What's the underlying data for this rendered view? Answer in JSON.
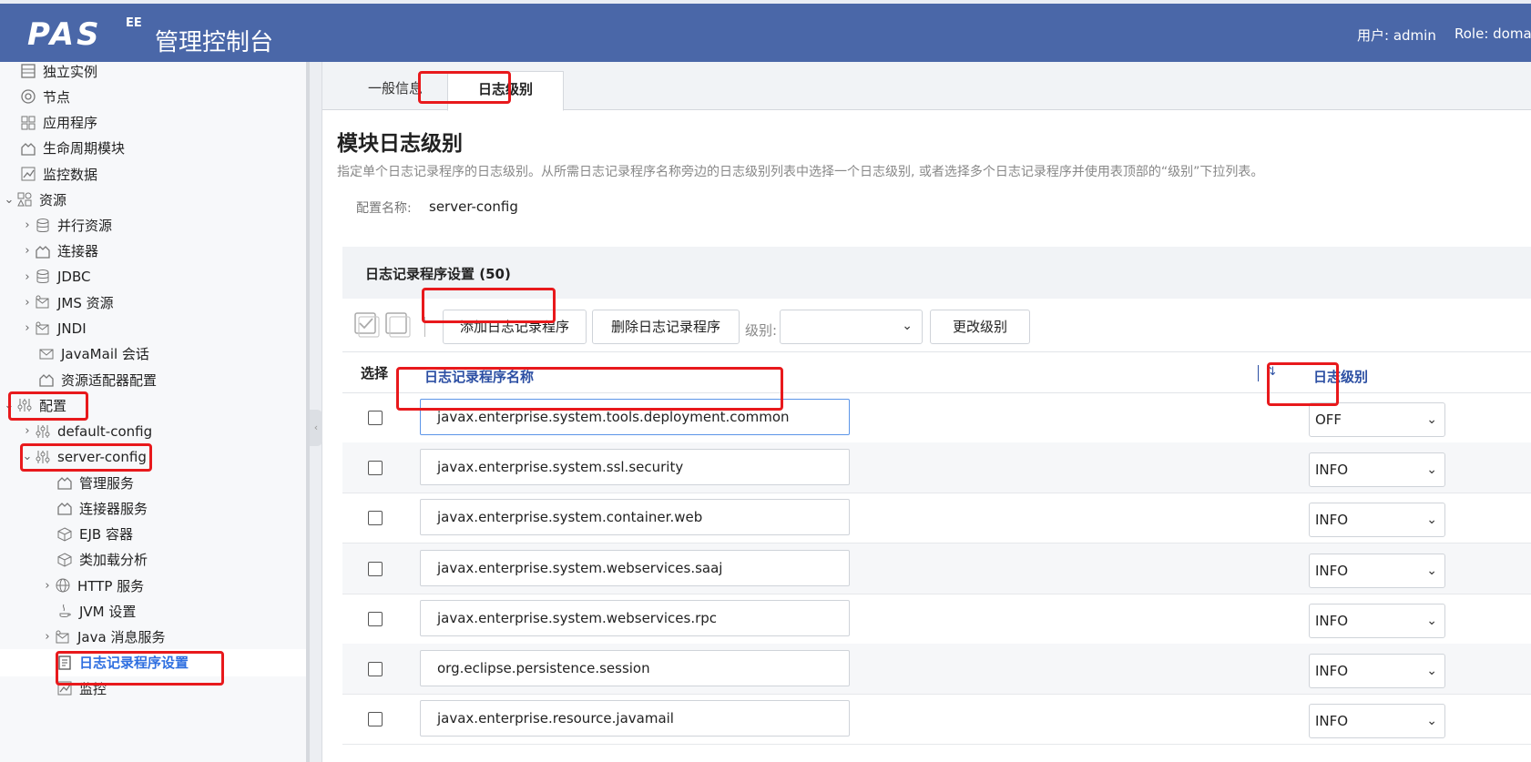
{
  "header": {
    "logo": "PAS",
    "logo_sup": "EE",
    "title": "管理控制台",
    "user": "用户: admin",
    "role": "Role: doma"
  },
  "sidebar": {
    "items": [
      {
        "label": "独立实例",
        "icon": "server-icon"
      },
      {
        "label": "节点",
        "icon": "node-icon"
      },
      {
        "label": "应用程序",
        "icon": "apps-icon"
      },
      {
        "label": "生命周期模块",
        "icon": "module-icon"
      },
      {
        "label": "监控数据",
        "icon": "chart-icon"
      },
      {
        "label": "资源",
        "icon": "resources-icon"
      },
      {
        "label": "并行资源",
        "icon": "database-icon"
      },
      {
        "label": "连接器",
        "icon": "module-icon"
      },
      {
        "label": "JDBC",
        "icon": "database-icon"
      },
      {
        "label": "JMS 资源",
        "icon": "jms-icon"
      },
      {
        "label": "JNDI",
        "icon": "jms-icon"
      },
      {
        "label": "JavaMail 会话",
        "icon": "mail-icon"
      },
      {
        "label": "资源适配器配置",
        "icon": "module-icon"
      },
      {
        "label": "配置",
        "icon": "sliders-icon"
      },
      {
        "label": "default-config",
        "icon": "sliders-icon"
      },
      {
        "label": "server-config",
        "icon": "sliders-icon"
      },
      {
        "label": "管理服务",
        "icon": "module-icon"
      },
      {
        "label": "连接器服务",
        "icon": "module-icon"
      },
      {
        "label": "EJB 容器",
        "icon": "cube-icon"
      },
      {
        "label": "类加载分析",
        "icon": "cube-icon"
      },
      {
        "label": "HTTP 服务",
        "icon": "globe-icon"
      },
      {
        "label": "JVM 设置",
        "icon": "java-icon"
      },
      {
        "label": "Java 消息服务",
        "icon": "jms-icon"
      },
      {
        "label": "日志记录程序设置",
        "icon": "log-icon"
      },
      {
        "label": "监控",
        "icon": "chart-icon"
      }
    ]
  },
  "tabs": {
    "general": "一般信息",
    "log_level": "日志级别"
  },
  "page": {
    "title": "模块日志级别",
    "description": "指定单个日志记录程序的日志级别。从所需日志记录程序名称旁边的日志级别列表中选择一个日志级别, 或者选择多个日志记录程序并使用表顶部的“级别”下拉列表。",
    "config_label": "配置名称:",
    "config_value": "server-config"
  },
  "table": {
    "caption": "日志记录程序设置 (50)",
    "toolbar": {
      "add": "添加日志记录程序",
      "delete": "删除日志记录程序",
      "level_label": "级别:",
      "level_value": "",
      "change": "更改级别"
    },
    "columns": {
      "select": "选择",
      "name": "日志记录程序名称",
      "level": "日志级别"
    },
    "rows": [
      {
        "name": "javax.enterprise.system.tools.deployment.common",
        "level": "OFF"
      },
      {
        "name": "javax.enterprise.system.ssl.security",
        "level": "INFO"
      },
      {
        "name": "javax.enterprise.system.container.web",
        "level": "INFO"
      },
      {
        "name": "javax.enterprise.system.webservices.saaj",
        "level": "INFO"
      },
      {
        "name": "javax.enterprise.system.webservices.rpc",
        "level": "INFO"
      },
      {
        "name": "org.eclipse.persistence.session",
        "level": "INFO"
      },
      {
        "name": "javax.enterprise.resource.javamail",
        "level": "INFO"
      }
    ]
  },
  "colors": {
    "header_bg": "#4a67a8",
    "annotation_red": "#e8191c",
    "link_blue": "#2c4fa3",
    "selected_blue": "#2f6fe0"
  }
}
